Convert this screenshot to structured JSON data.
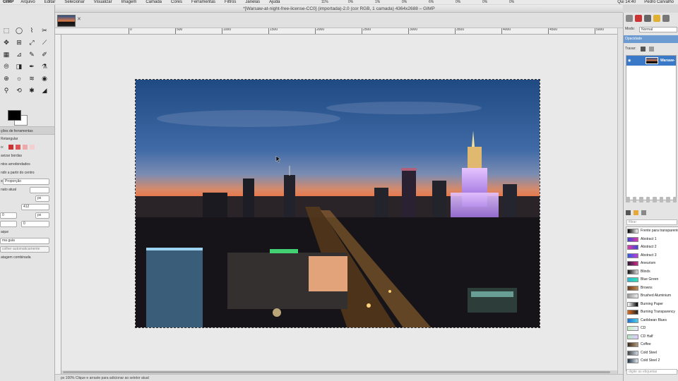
{
  "menubar": {
    "app": "GIMP",
    "items": [
      "Arquivo",
      "Editar",
      "Selecionar",
      "Visualizar",
      "Imagem",
      "Camada",
      "Cores",
      "Ferramentas",
      "Filtros",
      "Janelas",
      "Ajuda"
    ],
    "meters": [
      "11%",
      "0%",
      "1%",
      "0%",
      "6%",
      "0%",
      "0%",
      "0%"
    ],
    "clock": "Qui 14:40",
    "user": "Pedro Carvalho"
  },
  "window": {
    "title": "*[Warsaw-at-night-free-license-CC0] (importada)-2.0 (cor RGB, 1 camada) 4364x2688 – GIMP"
  },
  "toolbox": {
    "tools": [
      "⬚",
      "◯",
      "⌇",
      "✂",
      "✥",
      "⊞",
      "⤢",
      "⟋",
      "▦",
      "⊿",
      "✎",
      "✐",
      "⦾",
      "◨",
      "✒",
      "⚗",
      "⊕",
      "☼",
      "≋",
      "◉",
      "⚲",
      "⟲",
      "✱",
      "◢"
    ],
    "options": {
      "header": "ções de ferramentas",
      "tool": "Retangular",
      "mode_label": "o:",
      "suavizar": "avizar bordas",
      "alinhar": "ntos arredondados",
      "expandir": "ndir a partir do centro",
      "fixed_label": "xo",
      "fixed_value": "Proporção",
      "aspect": "nato atual",
      "size_unit": "px",
      "size_w": "412",
      "size_h": "0",
      "size_h2": "0",
      "unit2": "px",
      "destaque": "aque",
      "guia": "ma guia",
      "auto": "colher automaticamente",
      "mesclagem": "atagem combinada"
    }
  },
  "ruler": {
    "top": [
      "0",
      "500",
      "1000",
      "1500",
      "2000",
      "2500",
      "3000",
      "3500",
      "4000",
      "4500",
      "5000"
    ]
  },
  "status": {
    "text": "px   100%   Clique e arraste para adicionar ao seletor atual"
  },
  "dock": {
    "mode_label": "Modo:",
    "mode_value": "Normal",
    "opacity_label": "Opacidade",
    "lock_label": "Travar:",
    "layer_name": "Warsaw-at",
    "gradient_filter": "filtrar",
    "tag_placeholder": "digite as etiquetas",
    "gradients": [
      {
        "name": "Frente para transparente",
        "colors": [
          "#000000",
          "#ffffff"
        ]
      },
      {
        "name": "Abstract 1",
        "colors": [
          "#3b46d6",
          "#e23aa6"
        ]
      },
      {
        "name": "Abstract 2",
        "colors": [
          "#e23aa6",
          "#3b46d6"
        ]
      },
      {
        "name": "Abstract 3",
        "colors": [
          "#2b5be3",
          "#c43cd5"
        ]
      },
      {
        "name": "Aneurism",
        "colors": [
          "#2a1c3a",
          "#d22a8a"
        ]
      },
      {
        "name": "Blinds",
        "colors": [
          "#111111",
          "#dddddd"
        ]
      },
      {
        "name": "Blue Green",
        "colors": [
          "#2bb7d6",
          "#33e0b0"
        ]
      },
      {
        "name": "Browns",
        "colors": [
          "#6b3a1a",
          "#c28a55"
        ]
      },
      {
        "name": "Brushed Aluminium",
        "colors": [
          "#999999",
          "#eeeeee"
        ]
      },
      {
        "name": "Burning Paper",
        "colors": [
          "#ffffff",
          "#000000"
        ]
      },
      {
        "name": "Burning Transparency",
        "colors": [
          "#e36a1b",
          "#222222"
        ]
      },
      {
        "name": "Caribbean Blues",
        "colors": [
          "#1d6fd6",
          "#49d0e6"
        ]
      },
      {
        "name": "CD",
        "colors": [
          "#bdeebb",
          "#e8e8ff"
        ]
      },
      {
        "name": "CD Half",
        "colors": [
          "#b3e6c0",
          "#e0c8ff"
        ]
      },
      {
        "name": "Coffee",
        "colors": [
          "#3a2a1a",
          "#b49a7a"
        ]
      },
      {
        "name": "Cold Steel",
        "colors": [
          "#444444",
          "#cfdbe6"
        ]
      },
      {
        "name": "Cold Steel 2",
        "colors": [
          "#223344",
          "#dfe8ee"
        ]
      }
    ]
  },
  "colors": {
    "foreground": "#000000",
    "background": "#ffffff",
    "selection": "#3a79c8"
  }
}
